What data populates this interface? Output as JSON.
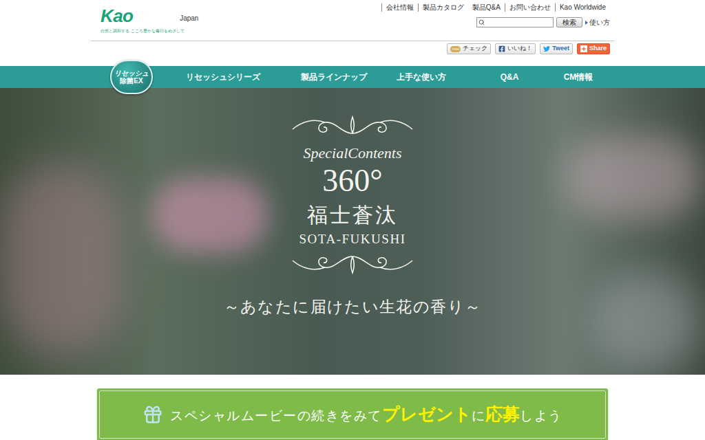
{
  "header": {
    "logo": "Kao",
    "tagline": "自然と調和する こころ豊かな毎日をめざして",
    "region": "Japan",
    "links": [
      "会社情報",
      "製品カタログ",
      "製品Q&A",
      "お問い合わせ",
      "Kao Worldwide"
    ],
    "search": {
      "placeholder": "",
      "button": "検索",
      "help": "使い方"
    }
  },
  "social": [
    {
      "kind": "mixi",
      "prefix": "mixi",
      "label": "チェック"
    },
    {
      "kind": "facebook",
      "prefix": "",
      "label": "いいね！"
    },
    {
      "kind": "twitter",
      "prefix": "",
      "label": "Tweet"
    },
    {
      "kind": "share",
      "prefix": "",
      "label": "Share"
    }
  ],
  "nav": {
    "badge": {
      "line1": "リセッシュ",
      "line2": "除菌EX"
    },
    "items": [
      {
        "label": "リセッシュシリーズ",
        "selected": false
      },
      {
        "label": "製品ラインナップ",
        "selected": false
      },
      {
        "label": "上手な使い方",
        "selected": false
      },
      {
        "label": "Q&A",
        "selected": false
      },
      {
        "label": "CM情報",
        "selected": false
      }
    ]
  },
  "hero": {
    "kicker": "SpecialContents",
    "number": "360°",
    "name": "福士蒼汰",
    "romaji": "SOTA-FUKUSHI",
    "tagline": "～あなたに届けたい生花の香り～"
  },
  "banner": {
    "segments": [
      {
        "text": "スペシャルムービーの続きをみて",
        "highlight": false
      },
      {
        "text": "プレゼント",
        "highlight": true
      },
      {
        "text": "に",
        "highlight": false
      },
      {
        "text": "応募",
        "highlight": true
      },
      {
        "text": "しよう",
        "highlight": false
      }
    ]
  }
}
